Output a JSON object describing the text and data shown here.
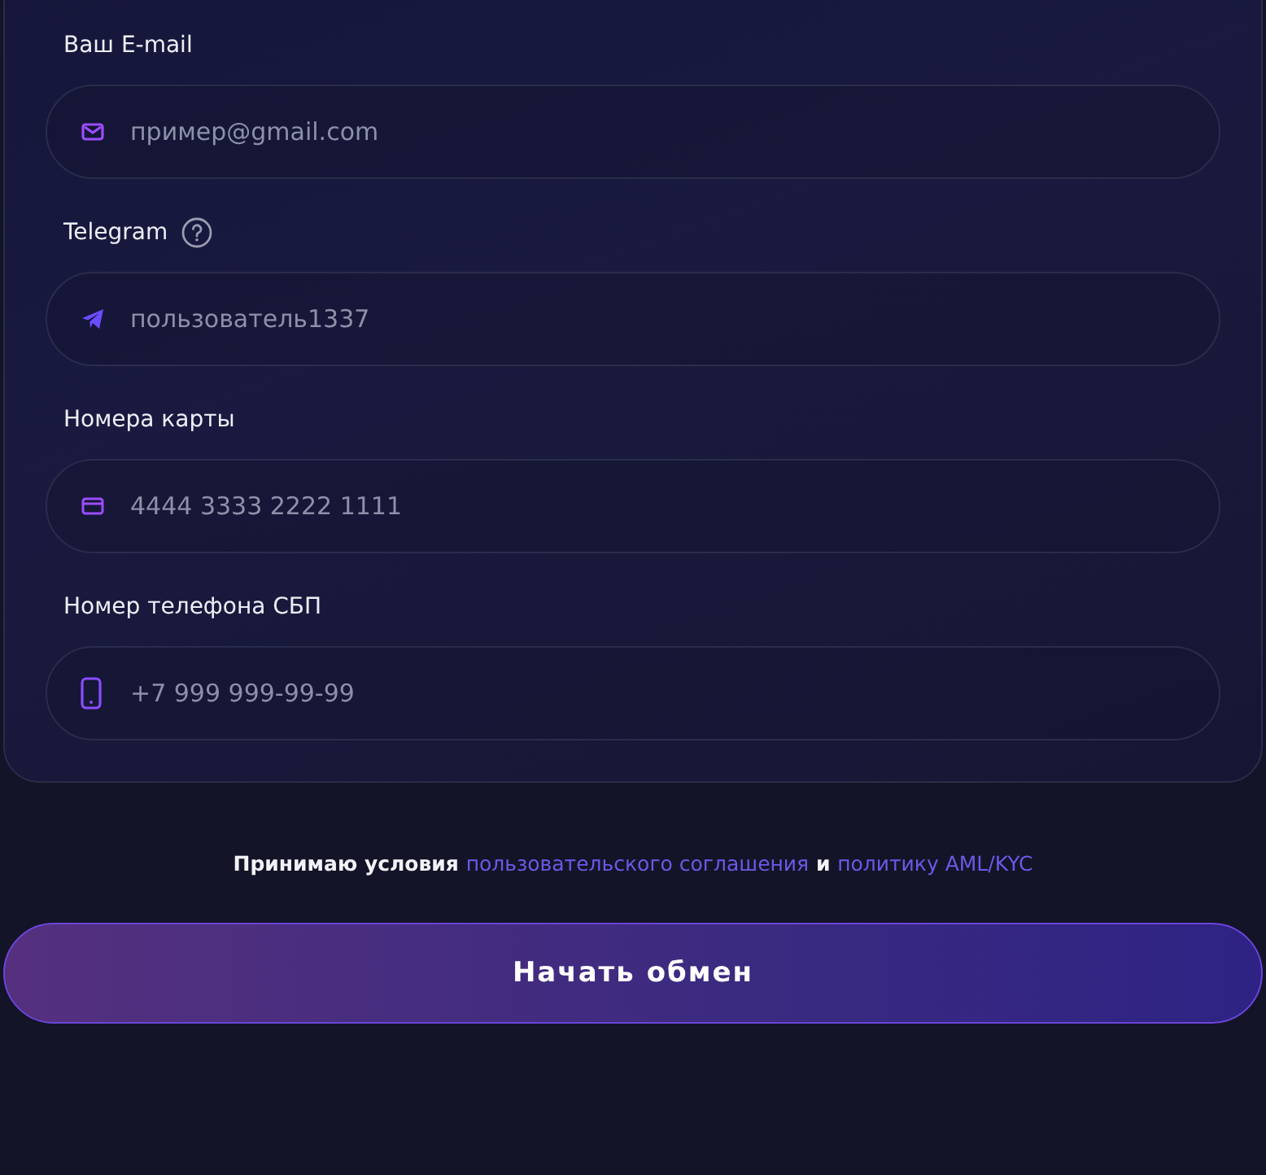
{
  "fields": [
    {
      "label": "Ваш E-mail",
      "kind": "email",
      "help": false,
      "placeholder": "пример@gmail.com"
    },
    {
      "label": "Telegram",
      "kind": "telegram",
      "help": true,
      "placeholder": "пользователь1337"
    },
    {
      "label": "Номера карты",
      "kind": "card",
      "help": false,
      "placeholder": "4444 3333 2222 1111"
    },
    {
      "label": "Номер телефона СБП",
      "kind": "phone",
      "help": false,
      "placeholder": "+7 999 999-99-99"
    }
  ],
  "agreement": {
    "before": "Принимаю условия",
    "link_terms": "пользовательского соглашения",
    "middle": "и",
    "link_policy": "политику AML/KYC"
  },
  "submit_button": "Начать обмен"
}
